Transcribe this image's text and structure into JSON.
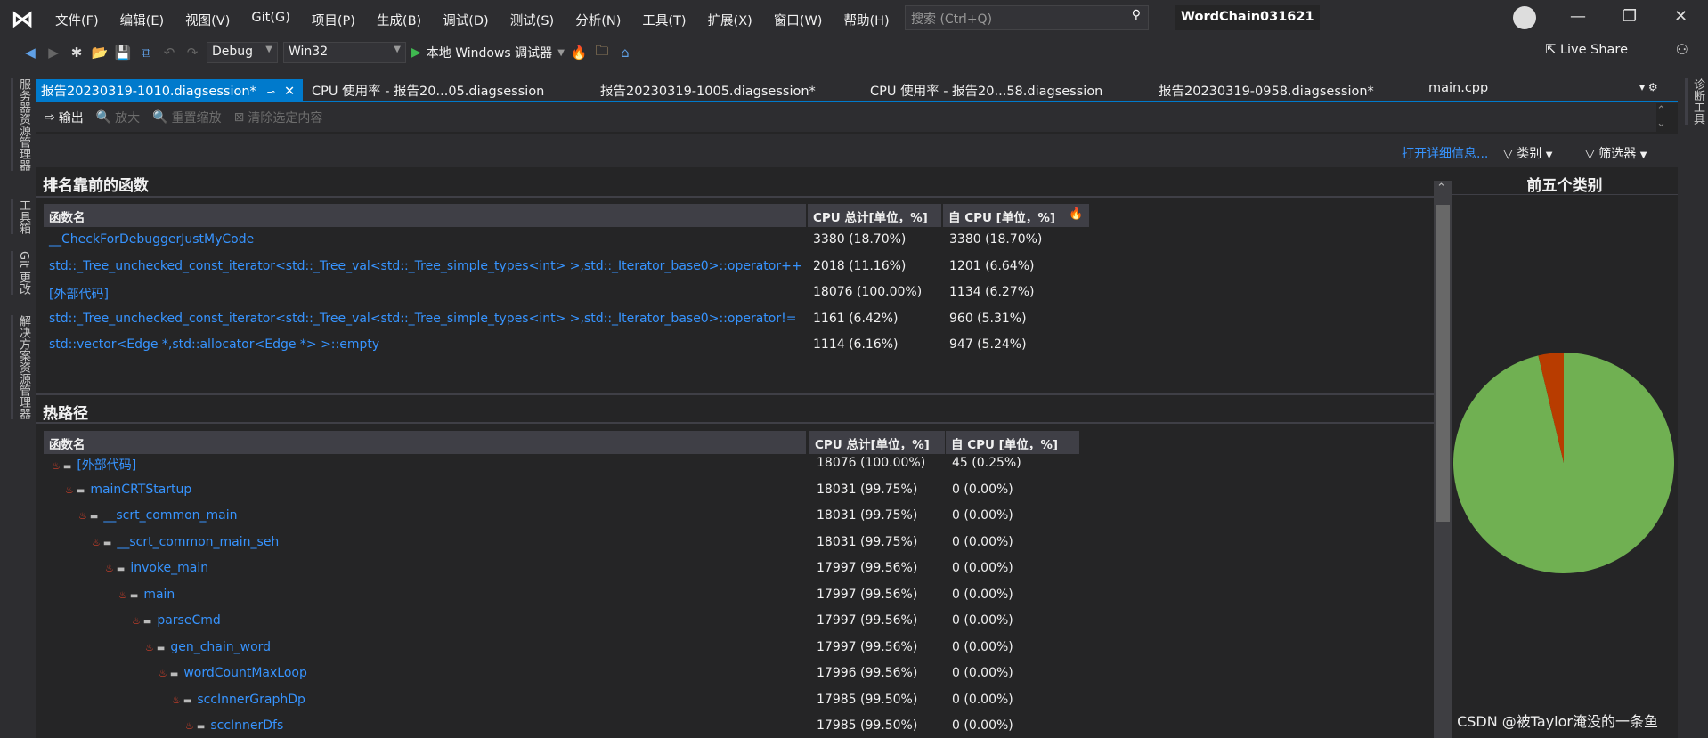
{
  "menubar": {
    "items": [
      "文件(F)",
      "编辑(E)",
      "视图(V)",
      "Git(G)",
      "项目(P)",
      "生成(B)",
      "调试(D)",
      "测试(S)",
      "分析(N)",
      "工具(T)",
      "扩展(X)",
      "窗口(W)",
      "帮助(H)"
    ],
    "search_placeholder": "搜索 (Ctrl+Q)",
    "project": "WordChain031621"
  },
  "toolbar": {
    "config": "Debug",
    "platform": "Win32",
    "run_label": "本地 Windows 调试器",
    "live_share": "Live Share"
  },
  "left_strip": [
    "服务器资源管理器",
    "工具箱",
    "Git 更改",
    "解决方案资源管理器"
  ],
  "right_strip": [
    "诊断工具"
  ],
  "tabs": [
    {
      "label": "报告20230319-1010.diagsession*",
      "active": true
    },
    {
      "label": "CPU 使用率 - 报告20...05.diagsession"
    },
    {
      "label": "报告20230319-1005.diagsession*"
    },
    {
      "label": "CPU 使用率 - 报告20...58.diagsession"
    },
    {
      "label": "报告20230319-0958.diagsession*"
    },
    {
      "label": "main.cpp"
    }
  ],
  "tools": {
    "output": "输出",
    "zoom_in": "放大",
    "reset_zoom": "重置缩放",
    "clear_selection": "清除选定内容"
  },
  "filters": {
    "open_details": "打开详细信息...",
    "category": "类别",
    "filter": "筛选器"
  },
  "top_functions": {
    "title": "排名靠前的函数",
    "columns": [
      "函数名",
      "CPU 总计[单位，%]",
      "自 CPU [单位，%]"
    ],
    "rows": [
      [
        "__CheckForDebuggerJustMyCode",
        "3380 (18.70%)",
        "3380 (18.70%)"
      ],
      [
        "std::_Tree_unchecked_const_iterator<std::_Tree_val<std::_Tree_simple_types<int> >,std::_Iterator_base0>::operator++",
        "2018 (11.16%)",
        "1201 (6.64%)"
      ],
      [
        "[外部代码]",
        "18076 (100.00%)",
        "1134 (6.27%)"
      ],
      [
        "std::_Tree_unchecked_const_iterator<std::_Tree_val<std::_Tree_simple_types<int> >,std::_Iterator_base0>::operator!=",
        "1161 (6.42%)",
        "960 (5.31%)"
      ],
      [
        "std::vector<Edge *,std::allocator<Edge *> >::empty",
        "1114 (6.16%)",
        "947 (5.24%)"
      ]
    ]
  },
  "hot_path": {
    "title": "热路径",
    "columns": [
      "函数名",
      "CPU 总计[单位，%]",
      "自 CPU [单位，%]"
    ],
    "rows": [
      [
        "[外部代码]",
        "18076 (100.00%)",
        "45 (0.25%)"
      ],
      [
        "mainCRTStartup",
        "18031 (99.75%)",
        "0 (0.00%)"
      ],
      [
        "__scrt_common_main",
        "18031 (99.75%)",
        "0 (0.00%)"
      ],
      [
        "__scrt_common_main_seh",
        "18031 (99.75%)",
        "0 (0.00%)"
      ],
      [
        "invoke_main",
        "17997 (99.56%)",
        "0 (0.00%)"
      ],
      [
        "main",
        "17997 (99.56%)",
        "0 (0.00%)"
      ],
      [
        "parseCmd",
        "17997 (99.56%)",
        "0 (0.00%)"
      ],
      [
        "gen_chain_word",
        "17997 (99.56%)",
        "0 (0.00%)"
      ],
      [
        "wordCountMaxLoop",
        "17996 (99.56%)",
        "0 (0.00%)"
      ],
      [
        "sccInnerGraphDp",
        "17985 (99.50%)",
        "0 (0.00%)"
      ],
      [
        "sccInnerDfs",
        "17985 (99.50%)",
        "0 (0.00%)"
      ]
    ]
  },
  "chart_data": {
    "type": "pie",
    "title": "前五个类别",
    "values": [
      96.3,
      3.7
    ],
    "colors": [
      "#70b052",
      "#b83c00"
    ]
  },
  "watermark": "CSDN @被Taylor淹没的一条鱼"
}
